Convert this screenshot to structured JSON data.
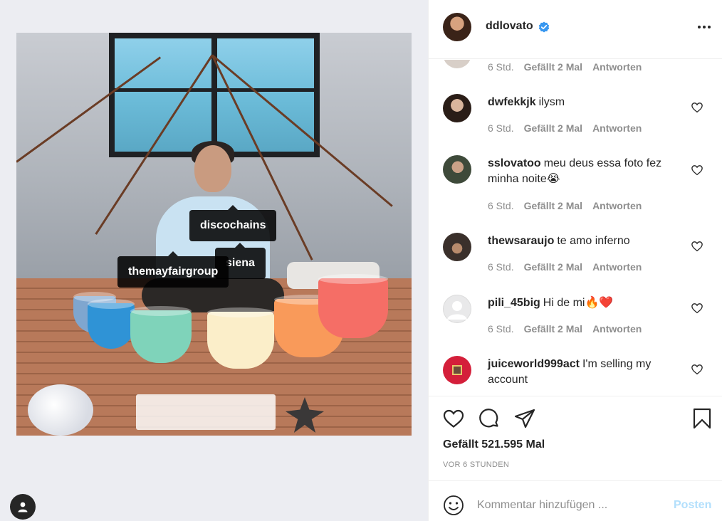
{
  "post": {
    "username": "ddlovato",
    "verified": true,
    "tags": [
      "discochains",
      "siena",
      "themayfairgroup"
    ]
  },
  "comments": [
    {
      "username": "",
      "text": "",
      "time": "6 Std.",
      "likes": "Gefällt 2 Mal",
      "reply": "Antworten",
      "partial": true
    },
    {
      "username": "dwfekkjk",
      "text": "ilysm",
      "time": "6 Std.",
      "likes": "Gefällt 2 Mal",
      "reply": "Antworten"
    },
    {
      "username": "sslovatoo",
      "text": "meu deus essa foto fez minha noite😭",
      "time": "6 Std.",
      "likes": "Gefällt 2 Mal",
      "reply": "Antworten"
    },
    {
      "username": "thewsaraujo",
      "text": "te amo inferno",
      "time": "6 Std.",
      "likes": "Gefällt 2 Mal",
      "reply": "Antworten"
    },
    {
      "username": "pili_45big",
      "text": "Hi de mi🔥❤️",
      "time": "6 Std.",
      "likes": "Gefällt 2 Mal",
      "reply": "Antworten"
    },
    {
      "username": "juiceworld999act",
      "text": "I'm selling my account",
      "time": "",
      "likes": "",
      "reply": ""
    }
  ],
  "actions": {
    "likes_text": "Gefällt 521.595 Mal",
    "time_ago": "VOR 6 STUNDEN"
  },
  "add_comment": {
    "placeholder": "Kommentar hinzufügen ...",
    "post_label": "Posten"
  },
  "colors": {
    "verified": "#3897f0",
    "post_disabled": "#b2dffc",
    "meta": "#8e8e8e",
    "text": "#262626"
  }
}
